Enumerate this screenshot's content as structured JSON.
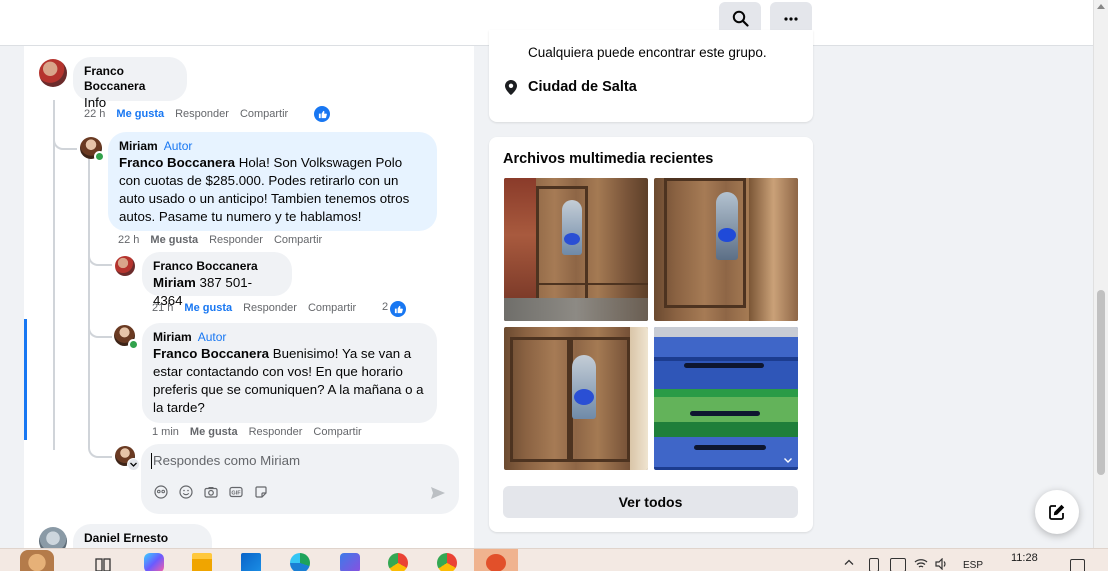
{
  "topbar": {
    "search_icon": "search-icon",
    "more_icon": "more-icon"
  },
  "comments": {
    "c1": {
      "author": "Franco Boccanera",
      "text": "Info",
      "time": "22 h",
      "like": "Me gusta",
      "reply": "Responder",
      "share": "Compartir"
    },
    "c2": {
      "author": "Miriam",
      "badge": "Autor",
      "mention": "Franco Boccanera",
      "text": " Hola! Son Volkswagen Polo con cuotas de $285.000. Podes retirarlo con un auto usado o un anticipo! Tambien tenemos otros autos. Pasame tu numero y te hablamos!",
      "time": "22 h",
      "like": "Me gusta",
      "reply": "Responder",
      "share": "Compartir"
    },
    "c3": {
      "author": "Franco Boccanera",
      "mention": "Miriam",
      "text": " 387 501-4364",
      "time": "21 h",
      "like": "Me gusta",
      "reply": "Responder",
      "share": "Compartir",
      "like_count": "2"
    },
    "c4": {
      "author": "Miriam",
      "badge": "Autor",
      "mention": "Franco Boccanera",
      "text": " Buenisimo! Ya se van a estar contactando con vos! En que horario preferis que se comuniquen? A la mañana o a la tarde?",
      "time": "1 min",
      "like": "Me gusta",
      "reply": "Responder",
      "share": "Compartir"
    },
    "c5": {
      "author": "Daniel Ernesto Lozano"
    }
  },
  "reply_box": {
    "placeholder": "Respondes como Miriam"
  },
  "group_info": {
    "visibility_text": "Cualquiera puede encontrar este grupo.",
    "location": "Ciudad de Salta"
  },
  "media": {
    "title": "Archivos multimedia recientes",
    "see_all": "Ver todos"
  },
  "taskbar": {
    "lang": "ESP",
    "time": "11:28"
  }
}
